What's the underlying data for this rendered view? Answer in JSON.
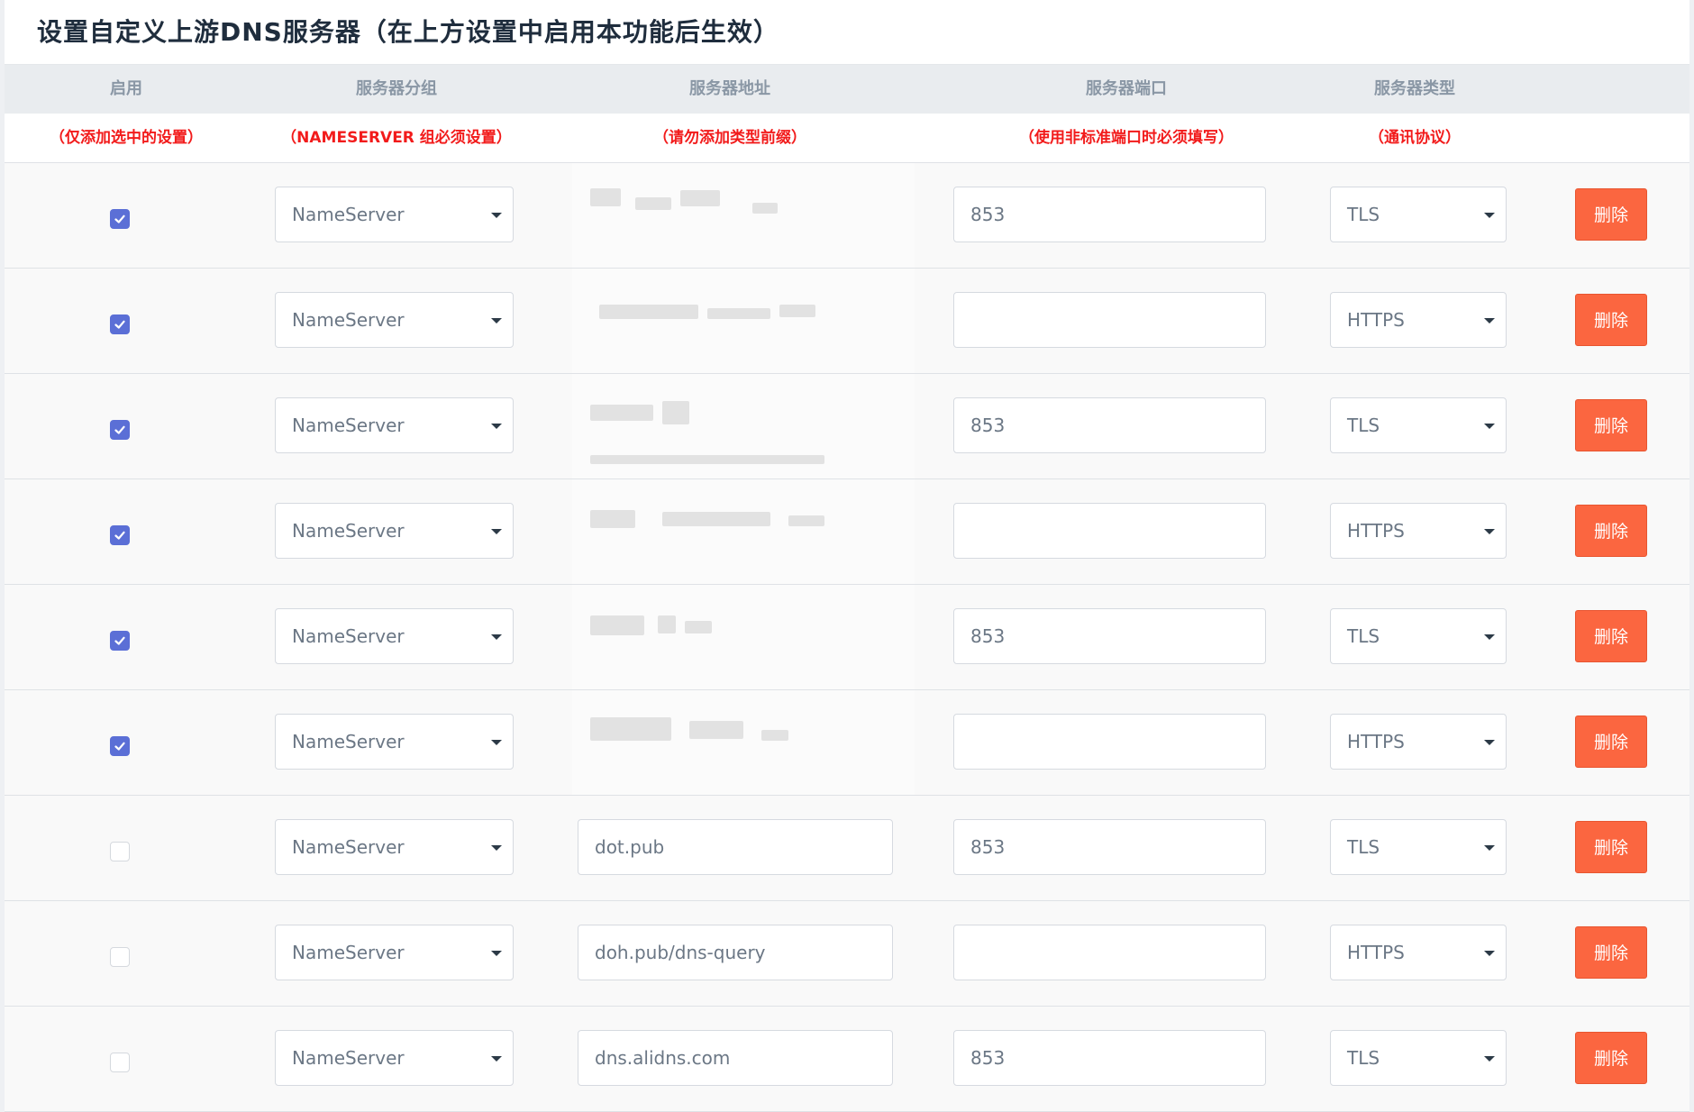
{
  "title": "设置自定义上游DNS服务器（在上方设置中启用本功能后生效）",
  "columns": [
    "启用",
    "服务器分组",
    "服务器地址",
    "服务器端口",
    "服务器类型"
  ],
  "hints": [
    "（仅添加选中的设置）",
    "（NAMESERVER 组必须设置）",
    "（请勿添加类型前缀）",
    "（使用非标准端口时必须填写）",
    "（通讯协议）"
  ],
  "delete_label": "删除",
  "rows": [
    {
      "enabled": true,
      "group": "NameServer",
      "address": "",
      "address_redacted": true,
      "port": "853",
      "type": "TLS"
    },
    {
      "enabled": true,
      "group": "NameServer",
      "address": "",
      "address_redacted": true,
      "port": "",
      "type": "HTTPS"
    },
    {
      "enabled": true,
      "group": "NameServer",
      "address": "",
      "address_redacted": true,
      "port": "853",
      "type": "TLS"
    },
    {
      "enabled": true,
      "group": "NameServer",
      "address": "",
      "address_redacted": true,
      "port": "",
      "type": "HTTPS"
    },
    {
      "enabled": true,
      "group": "NameServer",
      "address": "",
      "address_redacted": true,
      "port": "853",
      "type": "TLS"
    },
    {
      "enabled": true,
      "group": "NameServer",
      "address": "",
      "address_redacted": true,
      "port": "",
      "type": "HTTPS"
    },
    {
      "enabled": false,
      "group": "NameServer",
      "address": "dot.pub",
      "address_redacted": false,
      "port": "853",
      "type": "TLS"
    },
    {
      "enabled": false,
      "group": "NameServer",
      "address": "doh.pub/dns-query",
      "address_redacted": false,
      "port": "",
      "type": "HTTPS"
    },
    {
      "enabled": false,
      "group": "NameServer",
      "address": "dns.alidns.com",
      "address_redacted": false,
      "port": "853",
      "type": "TLS"
    }
  ],
  "colors": {
    "checkbox_on": "#5b6fd6",
    "delete_button": "#fb6640",
    "hint_text": "#f21b1b"
  }
}
